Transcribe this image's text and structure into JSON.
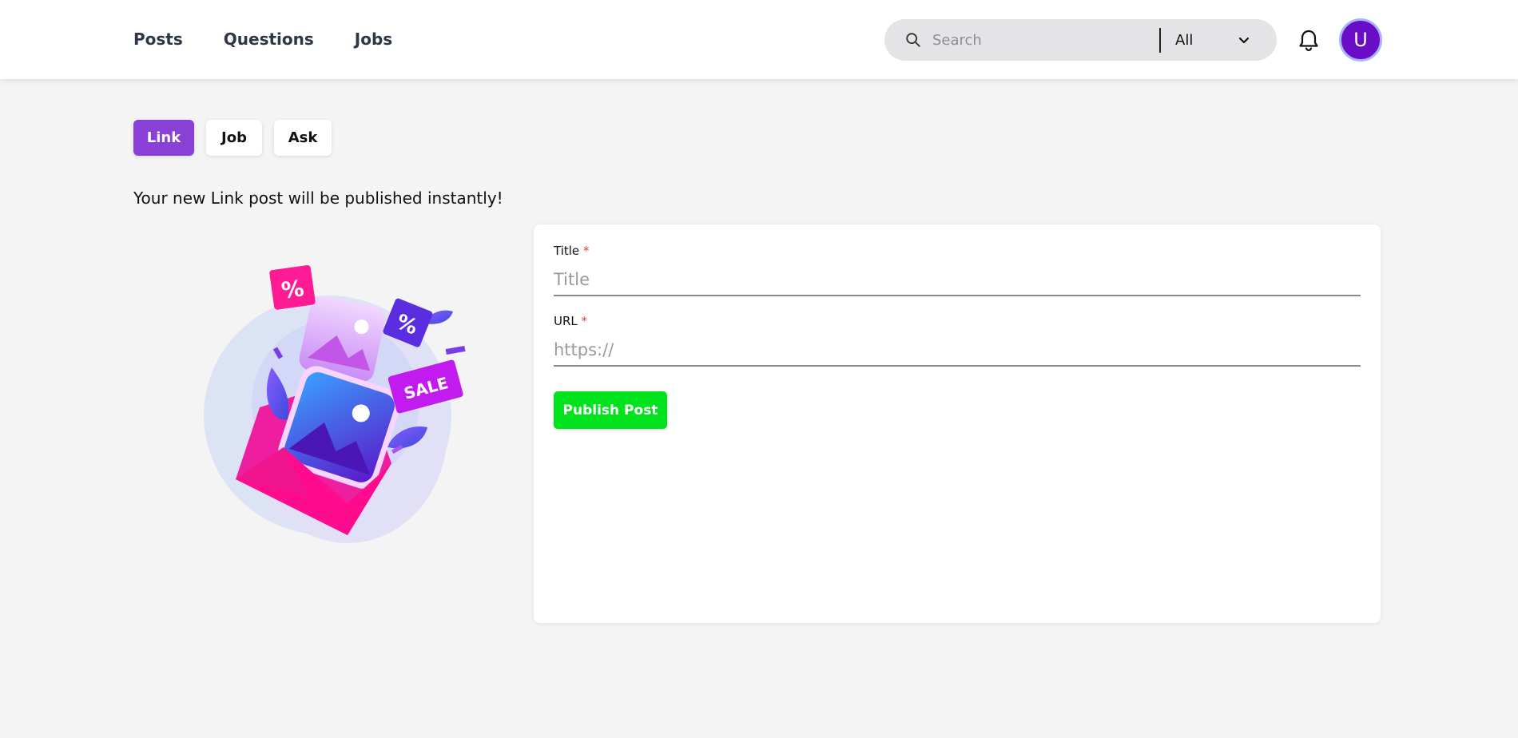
{
  "nav": {
    "links": [
      {
        "label": "Posts"
      },
      {
        "label": "Questions"
      },
      {
        "label": "Jobs"
      }
    ]
  },
  "search": {
    "placeholder": "Search",
    "value": "",
    "scope": "All"
  },
  "user": {
    "avatar_initial": "U"
  },
  "tabs": [
    {
      "label": "Link",
      "active": true
    },
    {
      "label": "Job",
      "active": false
    },
    {
      "label": "Ask",
      "active": false
    }
  ],
  "subtitle": "Your new Link post will be published instantly!",
  "illustration": {
    "badge_sale": "SALE",
    "badge_percent": "%"
  },
  "form": {
    "title_label": "Title",
    "title_placeholder": "Title",
    "title_value": "",
    "url_label": "URL",
    "url_placeholder": "https://",
    "url_value": "",
    "required_marker": "*",
    "submit_label": "Publish Post"
  },
  "colors": {
    "accent": "#8a3fd6",
    "publish": "#00e31c",
    "avatar": "#6a0dc7",
    "required": "#e53e3e"
  }
}
